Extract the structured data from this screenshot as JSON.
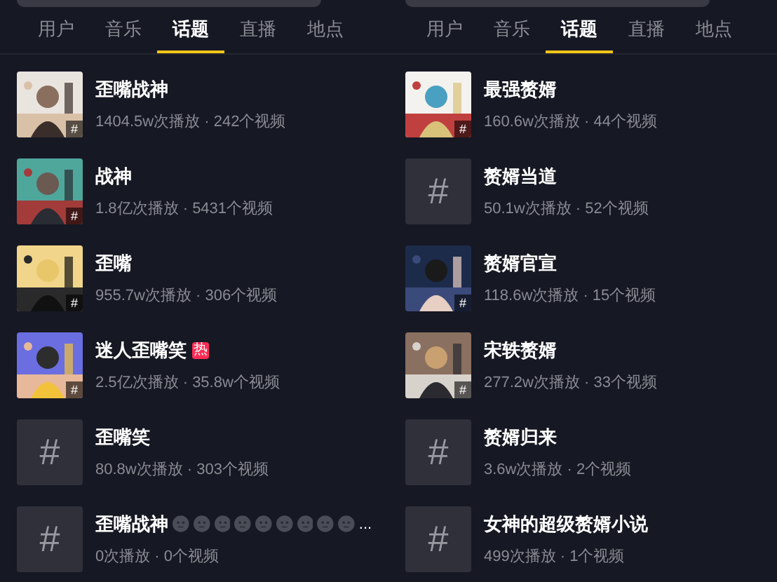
{
  "panels": [
    {
      "tabs": [
        {
          "label": "用户",
          "selected": false
        },
        {
          "label": "音乐",
          "selected": false
        },
        {
          "label": "话题",
          "selected": true
        },
        {
          "label": "直播",
          "selected": false
        },
        {
          "label": "地点",
          "selected": false
        }
      ],
      "topics": [
        {
          "thumb": {
            "kind": "picture",
            "badge": "#"
          },
          "title": "歪嘴战神",
          "stats": "1404.5w次播放 · 242个视频"
        },
        {
          "thumb": {
            "kind": "picture",
            "badge": "#"
          },
          "title": "战神",
          "stats": "1.8亿次播放 · 5431个视频"
        },
        {
          "thumb": {
            "kind": "picture",
            "badge": "#"
          },
          "title": "歪嘴",
          "stats": "955.7w次播放 · 306个视频"
        },
        {
          "thumb": {
            "kind": "picture",
            "badge": "#"
          },
          "title": "迷人歪嘴笑",
          "hot": "热",
          "stats": "2.5亿次播放 · 35.8w个视频"
        },
        {
          "thumb": {
            "kind": "placeholder",
            "symbol": "#"
          },
          "title": "歪嘴笑",
          "stats": "80.8w次播放 · 303个视频"
        },
        {
          "thumb": {
            "kind": "placeholder",
            "symbol": "#"
          },
          "title": "歪嘴战神",
          "emojis": [
            {
              "kind": "face"
            },
            {
              "kind": "face"
            },
            {
              "kind": "face"
            },
            {
              "kind": "face"
            },
            {
              "kind": "face"
            },
            {
              "kind": "face"
            },
            {
              "kind": "face"
            },
            {
              "kind": "face"
            },
            {
              "kind": "face"
            }
          ],
          "ellipsis": "...",
          "stats": "0次播放 · 0个视频"
        }
      ]
    },
    {
      "tabs": [
        {
          "label": "用户",
          "selected": false
        },
        {
          "label": "音乐",
          "selected": false
        },
        {
          "label": "话题",
          "selected": true
        },
        {
          "label": "直播",
          "selected": false
        },
        {
          "label": "地点",
          "selected": false
        }
      ],
      "topics": [
        {
          "thumb": {
            "kind": "picture",
            "badge": "#"
          },
          "title": "最强赘婿",
          "stats": "160.6w次播放 · 44个视频"
        },
        {
          "thumb": {
            "kind": "placeholder",
            "symbol": "#"
          },
          "title": "赘婿当道",
          "stats": "50.1w次播放 · 52个视频"
        },
        {
          "thumb": {
            "kind": "picture",
            "badge": "#"
          },
          "title": "赘婿官宣",
          "stats": "118.6w次播放 · 15个视频"
        },
        {
          "thumb": {
            "kind": "picture",
            "badge": "#"
          },
          "title": "宋轶赘婿",
          "stats": "277.2w次播放 · 33个视频"
        },
        {
          "thumb": {
            "kind": "placeholder",
            "symbol": "#"
          },
          "title": "赘婿归来",
          "stats": "3.6w次播放 · 2个视频"
        },
        {
          "thumb": {
            "kind": "placeholder",
            "symbol": "#"
          },
          "title": "女神的超级赘婿小说",
          "stats": "499次播放 · 1个视频"
        }
      ]
    }
  ]
}
